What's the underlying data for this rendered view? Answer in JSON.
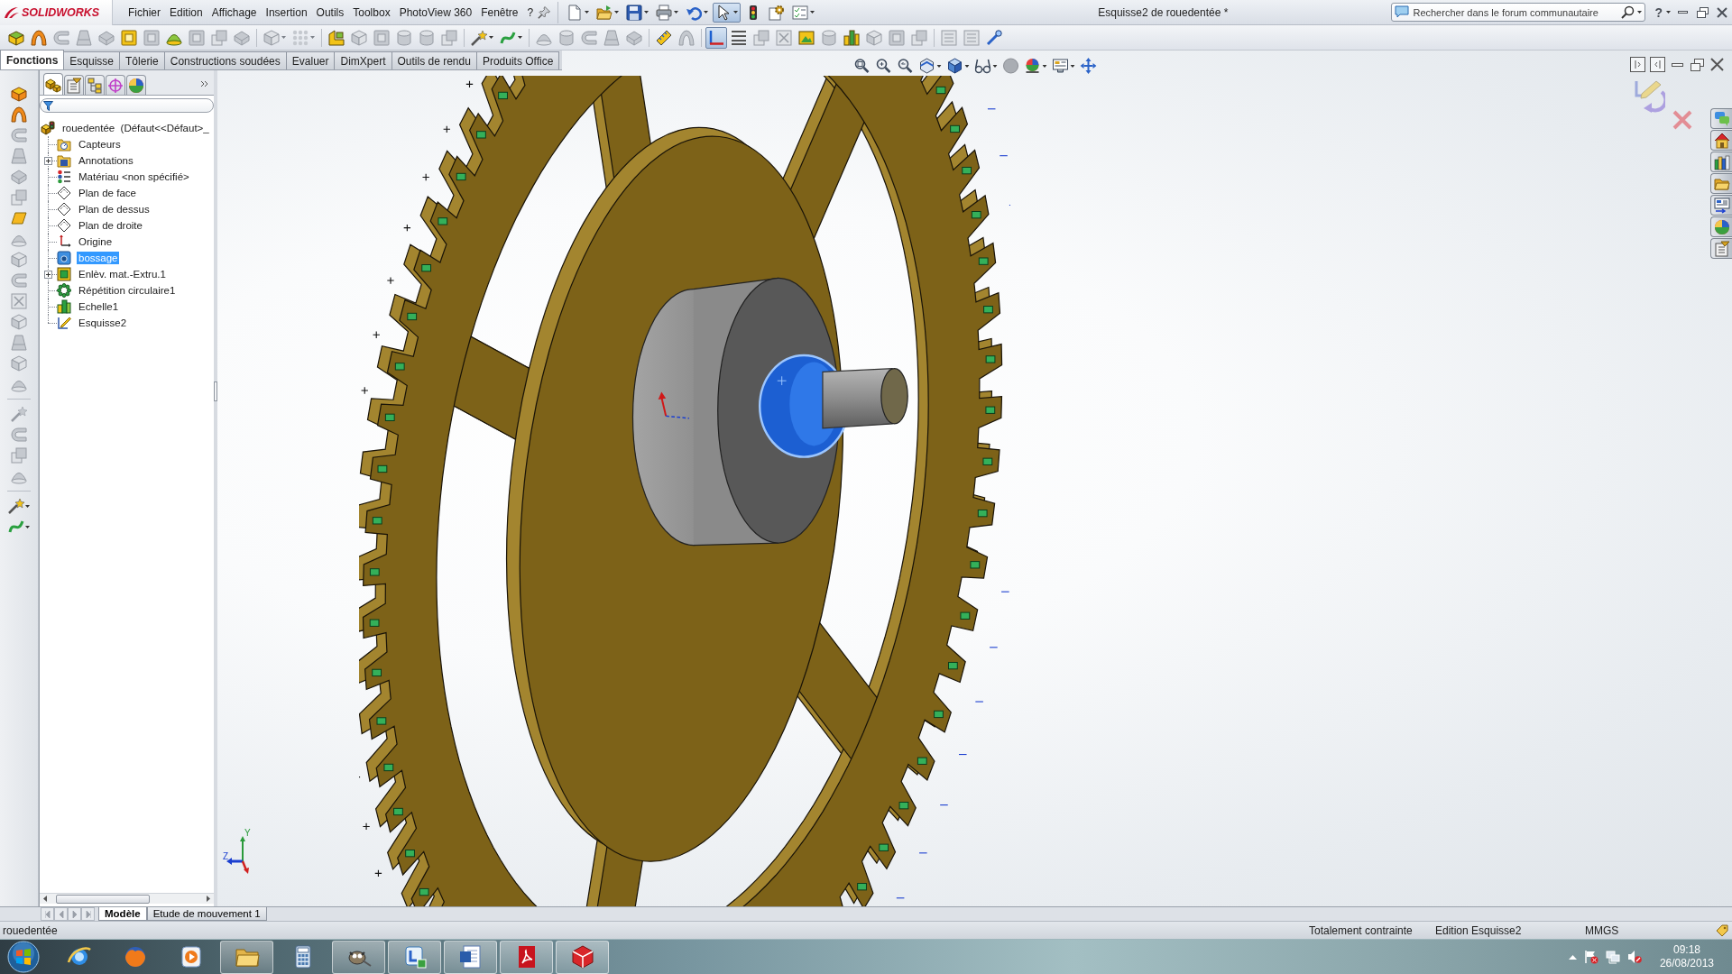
{
  "brand": {
    "name": "SOLIDWORKS"
  },
  "menu": [
    "Fichier",
    "Edition",
    "Affichage",
    "Insertion",
    "Outils",
    "Toolbox",
    "PhotoView 360",
    "Fenêtre",
    "?"
  ],
  "quick_access": [
    {
      "selected": false
    },
    {
      "selected": false
    },
    {
      "selected": false
    },
    {
      "selected": false
    },
    {
      "selected": false
    },
    {
      "selected": true
    },
    {
      "selected": false
    },
    {
      "selected": false
    },
    {
      "selected": false
    }
  ],
  "window": {
    "title": "Esquisse2 de rouedentée *"
  },
  "search": {
    "placeholder": "Rechercher dans le forum communautaire"
  },
  "help": {
    "label": "?"
  },
  "toolbar": [
    {
      "disabled": false,
      "selected": false
    },
    {
      "disabled": false,
      "selected": false
    },
    {
      "disabled": true,
      "selected": false
    },
    {
      "disabled": true,
      "selected": false
    },
    {
      "disabled": true,
      "selected": false
    },
    {
      "disabled": false,
      "selected": false
    },
    {
      "disabled": true,
      "selected": false
    },
    {
      "disabled": false,
      "selected": false
    },
    {
      "disabled": true,
      "selected": false
    },
    {
      "disabled": true,
      "selected": false
    },
    {
      "disabled": true,
      "selected": false
    },
    {
      "disabled": true,
      "selected": false
    },
    {
      "disabled": true,
      "selected": false
    },
    {
      "disabled": false,
      "selected": false
    },
    {
      "disabled": true,
      "selected": false
    },
    {
      "disabled": true,
      "selected": false
    },
    {
      "disabled": true,
      "selected": false
    },
    {
      "disabled": true,
      "selected": false
    },
    {
      "disabled": true,
      "selected": false
    },
    {
      "disabled": false,
      "selected": false
    },
    {
      "disabled": false,
      "selected": false
    },
    {
      "disabled": true,
      "selected": false
    },
    {
      "disabled": true,
      "selected": false
    },
    {
      "disabled": true,
      "selected": false
    },
    {
      "disabled": true,
      "selected": false
    },
    {
      "disabled": true,
      "selected": false
    },
    {
      "disabled": false,
      "selected": false
    },
    {
      "disabled": true,
      "selected": false
    },
    {
      "disabled": false,
      "selected": true
    },
    {
      "disabled": false,
      "selected": false
    },
    {
      "disabled": true,
      "selected": false
    },
    {
      "disabled": true,
      "selected": false
    },
    {
      "disabled": false,
      "selected": false
    },
    {
      "disabled": true,
      "selected": false
    },
    {
      "disabled": false,
      "selected": false
    },
    {
      "disabled": true,
      "selected": false
    },
    {
      "disabled": true,
      "selected": false
    },
    {
      "disabled": true,
      "selected": false
    },
    {
      "disabled": true,
      "selected": false
    },
    {
      "disabled": true,
      "selected": false
    },
    {
      "disabled": false,
      "selected": false
    }
  ],
  "command_tabs": [
    {
      "label": "Fonctions",
      "selected": true
    },
    {
      "label": "Esquisse",
      "selected": false
    },
    {
      "label": "Tôlerie",
      "selected": false
    },
    {
      "label": "Constructions soudées",
      "selected": false
    },
    {
      "label": "Evaluer",
      "selected": false
    },
    {
      "label": "DimXpert",
      "selected": false
    },
    {
      "label": "Outils de rendu",
      "selected": false
    },
    {
      "label": "Produits Office",
      "selected": false
    }
  ],
  "command_bar": [
    {
      "disabled": false
    },
    {
      "disabled": false
    },
    {
      "disabled": true
    },
    {
      "disabled": true
    },
    {
      "disabled": true
    },
    {
      "disabled": true
    },
    {
      "disabled": false
    },
    {
      "disabled": true
    },
    {
      "disabled": true
    },
    {
      "disabled": true
    },
    {
      "disabled": true
    },
    {
      "disabled": true
    },
    {
      "disabled": true
    },
    {
      "disabled": true
    },
    {
      "disabled": true
    },
    {
      "disabled": true
    },
    {
      "disabled": true
    },
    {
      "disabled": true
    },
    {
      "disabled": true
    },
    {
      "disabled": false
    },
    {
      "disabled": false
    }
  ],
  "feature_manager": {
    "panel_tabs": [
      {
        "selected": true
      },
      {
        "selected": false
      },
      {
        "selected": false
      },
      {
        "selected": false
      },
      {
        "selected": false
      }
    ],
    "tree": {
      "label": "rouedentée  (Défaut<<Défaut>_",
      "kind": "part",
      "selected": false,
      "children": [
        {
          "label": "Capteurs",
          "kind": "sensors",
          "selected": false
        },
        {
          "label": "Annotations",
          "kind": "annotations",
          "selected": false,
          "expanded": false
        },
        {
          "label": "Matériau <non spécifié>",
          "kind": "material",
          "selected": false
        },
        {
          "label": "Plan de face",
          "kind": "plane",
          "selected": false
        },
        {
          "label": "Plan de dessus",
          "kind": "plane",
          "selected": false
        },
        {
          "label": "Plan de droite",
          "kind": "plane",
          "selected": false
        },
        {
          "label": "Origine",
          "kind": "origin",
          "selected": false
        },
        {
          "label": "bossage",
          "kind": "boss",
          "selected": true
        },
        {
          "label": "Enlèv. mat.-Extru.1",
          "kind": "cut",
          "selected": false,
          "expanded": false
        },
        {
          "label": "Répétition circulaire1",
          "kind": "pattern",
          "selected": false
        },
        {
          "label": "Echelle1",
          "kind": "scale",
          "selected": false
        },
        {
          "label": "Esquisse2",
          "kind": "sketch",
          "selected": false
        }
      ]
    }
  },
  "model_tabs": [
    {
      "label": "Modèle",
      "selected": true
    },
    {
      "label": "Etude de mouvement 1",
      "selected": false
    }
  ],
  "triad": {
    "y_label": "Y",
    "z_label": "Z"
  },
  "status_bar": {
    "document": "rouedentée",
    "state": "Totalement contrainte",
    "mode": "Edition Esquisse2",
    "units": "MMGS"
  },
  "taskbar": {
    "apps": [
      {
        "running": false
      },
      {
        "running": false
      },
      {
        "running": false
      },
      {
        "running": true
      },
      {
        "running": false
      },
      {
        "running": true
      },
      {
        "running": true
      },
      {
        "running": true
      },
      {
        "running": true
      },
      {
        "running": true
      }
    ],
    "clock": {
      "time": "09:18",
      "date": "26/08/2013"
    }
  }
}
